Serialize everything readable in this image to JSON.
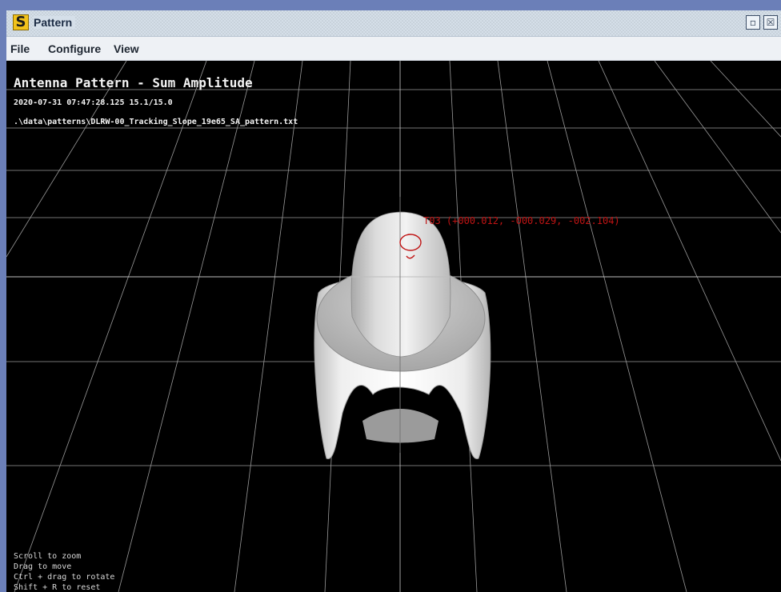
{
  "window": {
    "title": "Pattern",
    "app_icon_letter": "S",
    "restore_icon": "restore-icon",
    "close_icon": "close-icon"
  },
  "menu": {
    "items": [
      {
        "label": "File"
      },
      {
        "label": "Configure"
      },
      {
        "label": "View"
      }
    ]
  },
  "plot": {
    "title": "Antenna Pattern - Sum Amplitude",
    "timestamp": "2020-07-31 07:47:28.125 15.1/15.0",
    "file_path": ".\\data\\patterns\\DLRW-00_Tracking_Slope_19e65_SA_pattern.txt",
    "marker_label": "T03 (+000.012, -000.029, -002.104)",
    "marker_color": "#c01414",
    "surface_color": "#e6e6e6",
    "grid_color": "#9a9a9a"
  },
  "hints": [
    "Scroll to zoom",
    "Drag to move",
    "Ctrl + drag to rotate",
    "Shift + R to reset"
  ]
}
